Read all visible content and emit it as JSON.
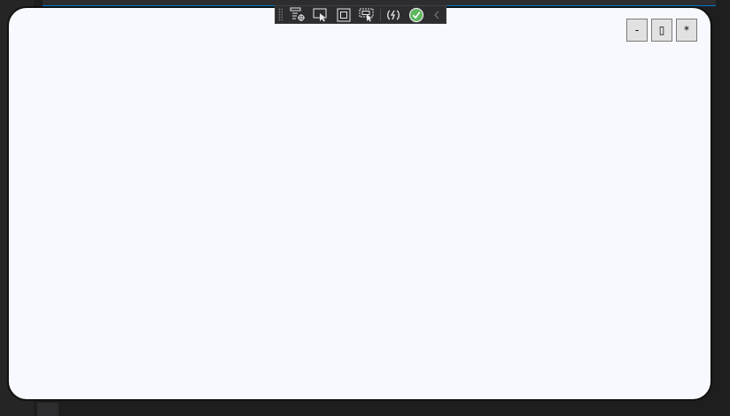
{
  "window_controls": {
    "minimize_label": "-",
    "maximize_label": "▯",
    "close_label": "*"
  },
  "debug_toolbar": {
    "icons": [
      "live-visual-tree-icon",
      "select-element-icon",
      "display-layout-adorners-icon",
      "track-focus-icon",
      "hot-reload-icon",
      "binding-status-ok-icon",
      "collapse-toolbar-icon"
    ]
  },
  "colors": {
    "window_background": "#f7f9fe",
    "ide_background": "#1e1e1e",
    "toolbar_background": "#2d2d30",
    "status_ok_green": "#5cb85c"
  }
}
